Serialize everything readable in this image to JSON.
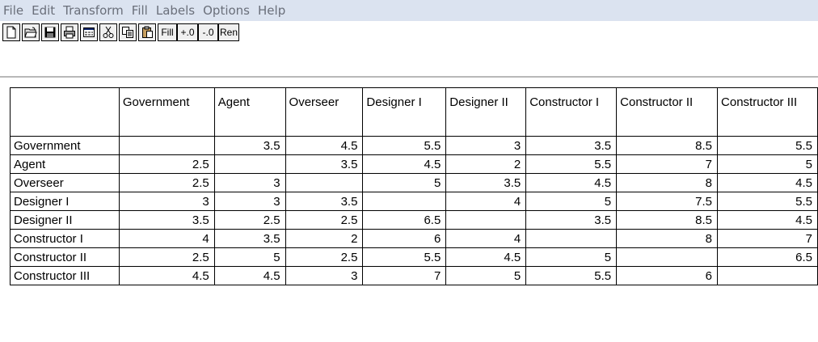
{
  "menu": [
    "File",
    "Edit",
    "Transform",
    "Fill",
    "Labels",
    "Options",
    "Help"
  ],
  "toolbar": {
    "icons": [
      "new-file-icon",
      "open-folder-icon",
      "save-disk-icon",
      "print-icon",
      "window-icon",
      "cut-scissors-icon",
      "copy-icon",
      "paste-icon"
    ],
    "fill_label": "Fill",
    "plus_label": "+.0",
    "minus_label": "-.0",
    "ren_label": "Ren"
  },
  "grid": {
    "columns": [
      "",
      "Government",
      "Agent",
      "Overseer",
      "Designer I",
      "Designer II",
      "Constructor I",
      "Constructor II",
      "Constructor III"
    ],
    "rows": [
      {
        "label": "Government",
        "values": [
          "",
          "3.5",
          "4.5",
          "5.5",
          "3",
          "3.5",
          "8.5",
          "5.5"
        ]
      },
      {
        "label": "Agent",
        "values": [
          "2.5",
          "",
          "3.5",
          "4.5",
          "2",
          "5.5",
          "7",
          "5"
        ]
      },
      {
        "label": "Overseer",
        "values": [
          "2.5",
          "3",
          "",
          "5",
          "3.5",
          "4.5",
          "8",
          "4.5"
        ]
      },
      {
        "label": "Designer I",
        "values": [
          "3",
          "3",
          "3.5",
          "",
          "4",
          "5",
          "7.5",
          "5.5"
        ]
      },
      {
        "label": "Designer II",
        "values": [
          "3.5",
          "2.5",
          "2.5",
          "6.5",
          "",
          "3.5",
          "8.5",
          "4.5"
        ]
      },
      {
        "label": "Constructor I",
        "values": [
          "4",
          "3.5",
          "2",
          "6",
          "4",
          "",
          "8",
          "7"
        ]
      },
      {
        "label": "Constructor II",
        "values": [
          "2.5",
          "5",
          "2.5",
          "5.5",
          "4.5",
          "5",
          "",
          "6.5"
        ]
      },
      {
        "label": "Constructor III",
        "values": [
          "4.5",
          "4.5",
          "3",
          "7",
          "5",
          "5.5",
          "6",
          ""
        ]
      }
    ]
  }
}
